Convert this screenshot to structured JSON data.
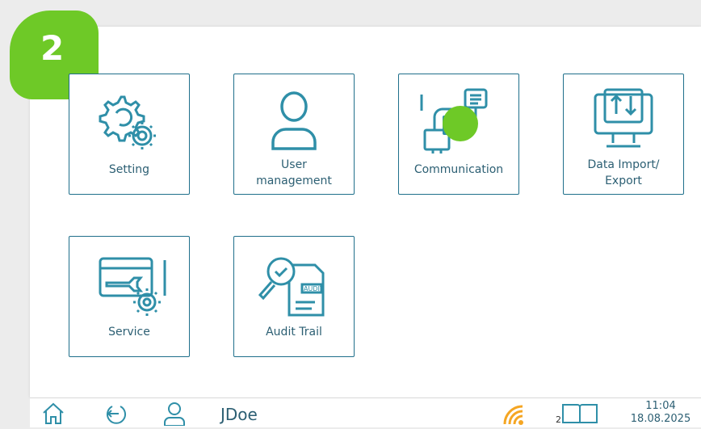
{
  "step_badge": "2",
  "tiles": [
    {
      "label": "Setting",
      "icon": "gear-icon"
    },
    {
      "label": "User\nmanagement",
      "icon": "user-icon"
    },
    {
      "label": "Communication",
      "icon": "communication-icon"
    },
    {
      "label": "Data Import/\nExport",
      "icon": "data-import-export-icon"
    },
    {
      "label": "Service",
      "icon": "service-icon"
    },
    {
      "label": "Audit Trail",
      "icon": "audit-trail-icon"
    }
  ],
  "status_bar": {
    "user": "JDoe",
    "wifi_level": "2",
    "time": "11:04",
    "date": "18.08.2025"
  },
  "colors": {
    "accent": "#6ec927",
    "primary": "#1f6f8b",
    "icon": "#2f8fa8"
  }
}
